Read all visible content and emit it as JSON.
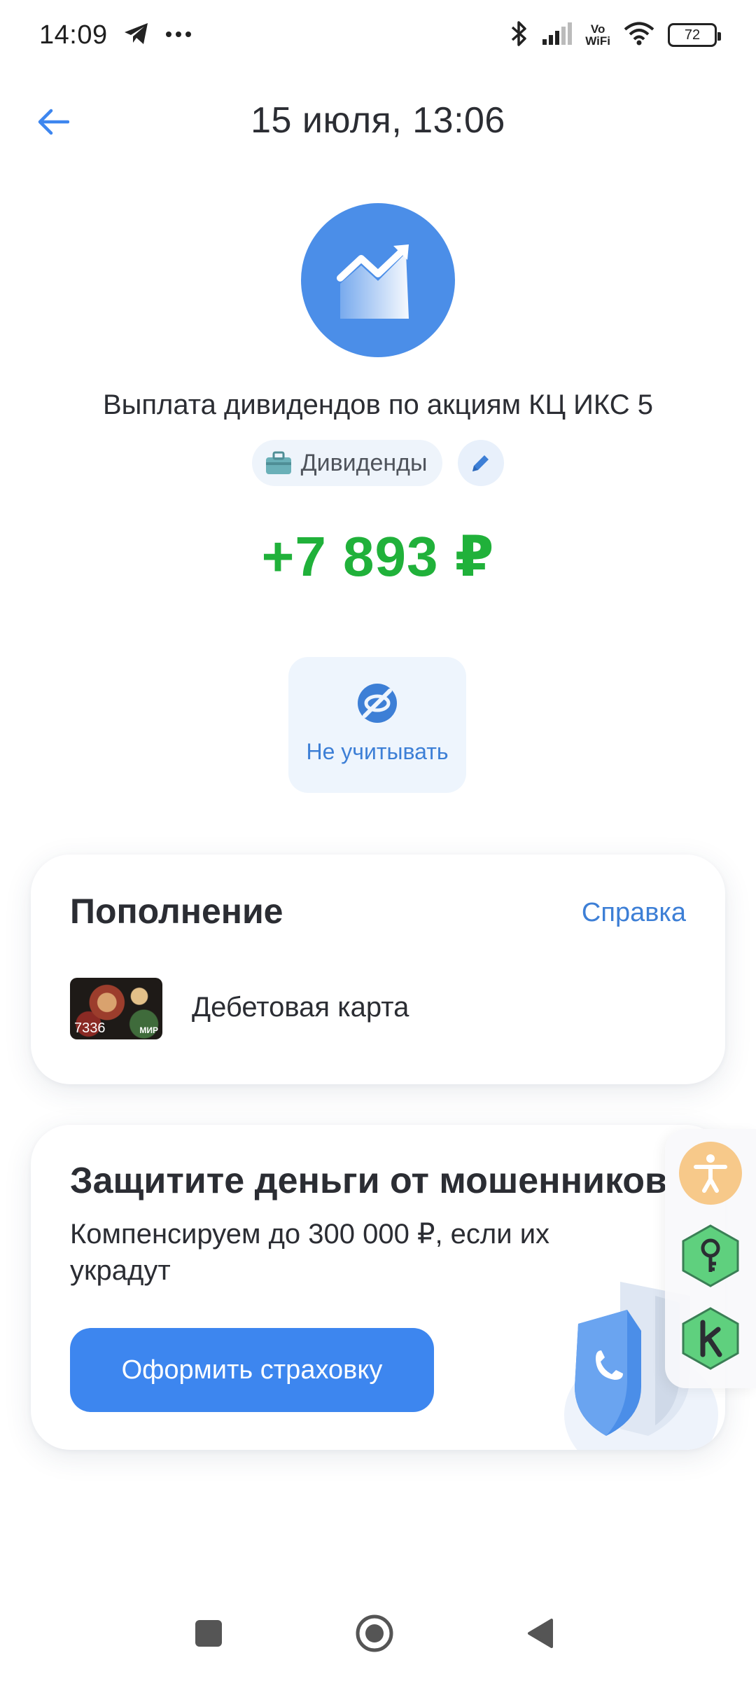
{
  "status_bar": {
    "time": "14:09",
    "vowifi_top": "Vo",
    "vowifi_bottom": "WiFi",
    "battery": "72",
    "icons": [
      "telegram-icon",
      "more-dots-icon",
      "bluetooth-icon",
      "signal-icon",
      "vowifi-icon",
      "wifi-icon",
      "battery-icon"
    ]
  },
  "header": {
    "title": "15 июля, 13:06",
    "back_icon": "arrow-left-icon"
  },
  "operation": {
    "icon": "growth-chart-icon",
    "description": "Выплата дивидендов по акциям КЦ ИКС 5",
    "category": "Дивиденды",
    "category_icon": "briefcase-icon",
    "edit_icon": "pencil-icon",
    "amount": "+7 893 ₽",
    "exclude_label": "Не учитывать",
    "exclude_icon": "eye-off-icon"
  },
  "topup_card": {
    "title": "Пополнение",
    "help_link": "Справка",
    "card_number": "7336",
    "card_system": "МИР",
    "card_name": "Дебетовая карта"
  },
  "insurance_card": {
    "title": "Защитите деньги от мошенников",
    "subtitle": "Компенсируем до 300 000 ₽, если их украдут",
    "button_label": "Оформить страховку",
    "art_icon": "shield-phone-icon"
  },
  "floating_panel": {
    "items": [
      "accessibility-icon",
      "key-icon",
      "kaspersky-icon"
    ]
  },
  "colors": {
    "accent": "#3d86ef",
    "amount_green": "#20b13a",
    "link_blue": "#3d7fd6",
    "icon_circle": "#4b8ee8"
  },
  "nav_bar": {
    "items": [
      "recents-square-icon",
      "home-circle-icon",
      "back-triangle-icon"
    ]
  }
}
